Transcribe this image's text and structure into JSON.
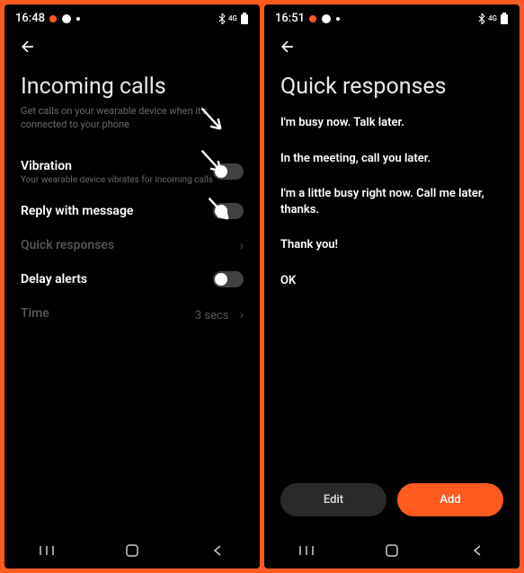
{
  "screen1": {
    "status": {
      "time": "16:48"
    },
    "title": "Incoming calls",
    "subtitle": "Get calls on your wearable device when it's connected to your phone",
    "vibration": {
      "label": "Vibration",
      "sub": "Your wearable device vibrates for incoming calls"
    },
    "reply": {
      "label": "Reply with message"
    },
    "quick": {
      "label": "Quick responses"
    },
    "delay": {
      "label": "Delay alerts"
    },
    "time_row": {
      "label": "Time",
      "value": "3 secs"
    }
  },
  "screen2": {
    "status": {
      "time": "16:51"
    },
    "title": "Quick responses",
    "responses": [
      "I'm busy now. Talk later.",
      "In the meeting, call you later.",
      "I'm a little busy right now. Call me later, thanks.",
      "Thank you!",
      "OK"
    ],
    "edit": "Edit",
    "add": "Add"
  }
}
